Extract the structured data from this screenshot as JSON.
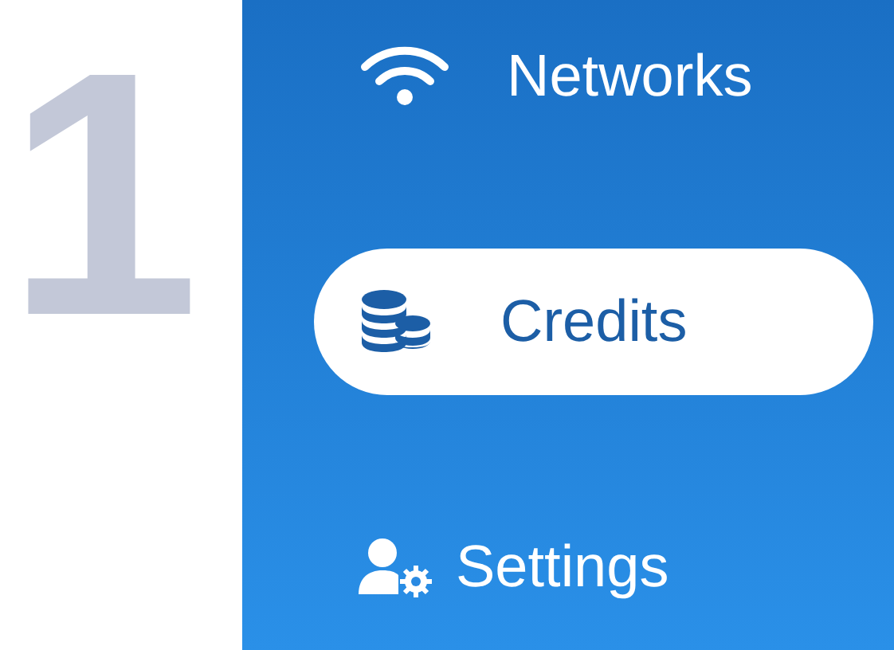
{
  "step_number": "1",
  "menu": [
    {
      "label": "Networks",
      "selected": false
    },
    {
      "label": "Credits",
      "selected": true
    },
    {
      "label": "Settings",
      "selected": false
    }
  ]
}
